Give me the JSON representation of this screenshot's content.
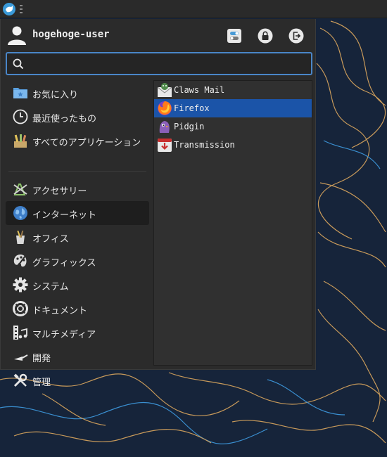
{
  "user": {
    "name": "hogehoge-user"
  },
  "search": {
    "placeholder": "",
    "value": ""
  },
  "categories": [
    {
      "label": "お気に入り",
      "icon": "favorites-folder-icon"
    },
    {
      "label": "最近使ったもの",
      "icon": "clock-icon"
    },
    {
      "label": "すべてのアプリケーション",
      "icon": "all-applications-icon"
    },
    {
      "label": "アクセサリー",
      "icon": "accessories-icon"
    },
    {
      "label": "インターネット",
      "icon": "globe-icon",
      "active": true
    },
    {
      "label": "オフィス",
      "icon": "office-icon"
    },
    {
      "label": "グラフィックス",
      "icon": "palette-icon"
    },
    {
      "label": "システム",
      "icon": "gear-icon"
    },
    {
      "label": "ドキュメント",
      "icon": "lifebuoy-icon"
    },
    {
      "label": "マルチメディア",
      "icon": "film-music-icon"
    },
    {
      "label": "開発",
      "icon": "trowel-icon"
    },
    {
      "label": "管理",
      "icon": "tools-icon"
    }
  ],
  "apps": [
    {
      "label": "Claws Mail",
      "icon": "claws-mail-icon"
    },
    {
      "label": "Firefox",
      "icon": "firefox-icon",
      "selected": true
    },
    {
      "label": "Pidgin",
      "icon": "pidgin-icon"
    },
    {
      "label": "Transmission",
      "icon": "transmission-icon"
    }
  ],
  "colors": {
    "desktop": "#16243a",
    "panel": "#2b2b2b",
    "selection": "#1b54a8",
    "search_border": "#4a86c8"
  }
}
